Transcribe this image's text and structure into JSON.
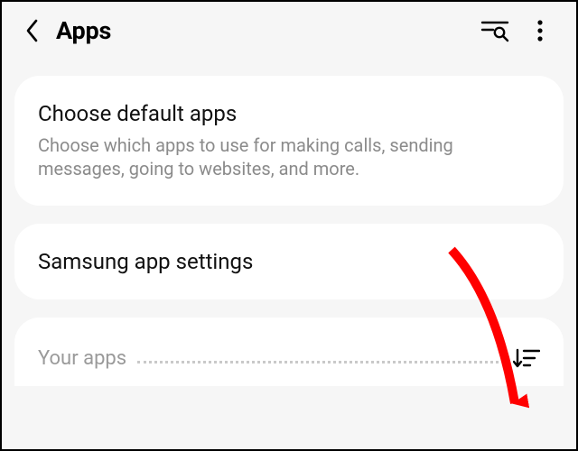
{
  "header": {
    "title": "Apps"
  },
  "card1": {
    "title": "Choose default apps",
    "subtitle": "Choose which apps to use for making calls, sending messages, going to websites, and more."
  },
  "card2": {
    "title": "Samsung app settings"
  },
  "section": {
    "label": "Your apps"
  }
}
